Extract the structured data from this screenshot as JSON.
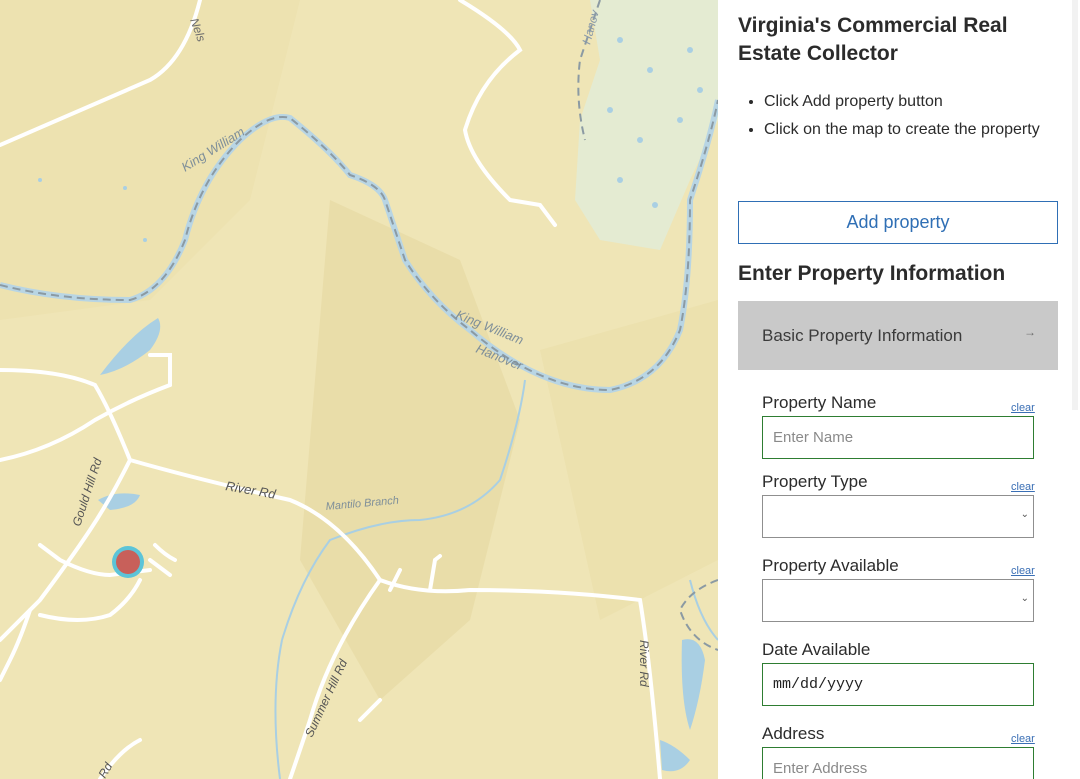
{
  "map": {
    "labels": {
      "nelson": "Nels",
      "hanover_top": "Hanov",
      "king_william_1": "King William",
      "king_william_2": "King William",
      "hanover_2": "Hanover",
      "gould_hill": "Gould Hill Rd",
      "river_rd": "River Rd",
      "mantilo": "Mantilo Branch",
      "summer_hill": "Summer Hill Rd",
      "river_rd_vertical": "River Rd",
      "rd_bottom": "Rd"
    },
    "colors": {
      "land": "#efe5b6",
      "road": "#ffffff",
      "water": "#a9cfe3",
      "boundary": "#8b9aa3",
      "marker_fill": "#c8605a",
      "marker_ring": "#5cc4d8"
    }
  },
  "panel": {
    "title": "Virginia's Commercial Real Estate Collector",
    "steps": [
      "Click Add property button",
      "Click on the map to create the property"
    ],
    "add_button": "Add property",
    "section_heading": "Enter Property Information",
    "accordion": {
      "label": "Basic Property Information",
      "arrow": "→"
    },
    "fields": {
      "name": {
        "label": "Property Name",
        "clear": "clear",
        "placeholder": "Enter Name"
      },
      "type": {
        "label": "Property Type",
        "clear": "clear"
      },
      "available": {
        "label": "Property Available",
        "clear": "clear"
      },
      "date": {
        "label": "Date Available",
        "value": "mm/dd/yyyy"
      },
      "address": {
        "label": "Address",
        "clear": "clear",
        "placeholder": "Enter Address"
      }
    }
  }
}
